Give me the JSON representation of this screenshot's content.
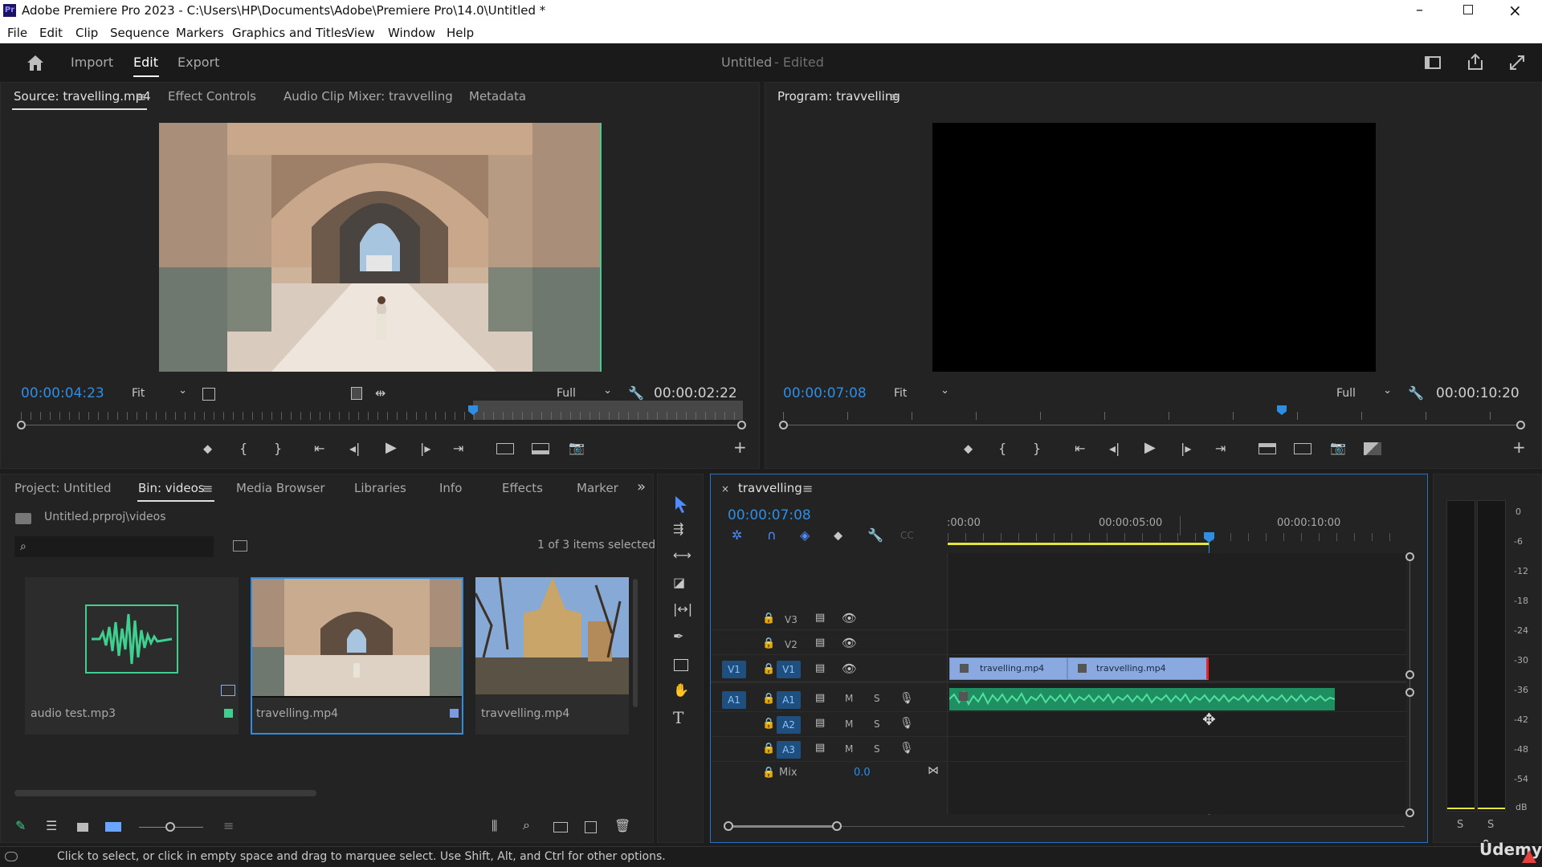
{
  "window": {
    "title": "Adobe Premiere Pro 2023 - C:\\Users\\HP\\Documents\\Adobe\\Premiere Pro\\14.0\\Untitled *",
    "app_icon": "Pr"
  },
  "menu": [
    "File",
    "Edit",
    "Clip",
    "Sequence",
    "Markers",
    "Graphics and Titles",
    "View",
    "Window",
    "Help"
  ],
  "header": {
    "tabs": [
      "Import",
      "Edit",
      "Export"
    ],
    "active_tab": "Edit",
    "project_title": "Untitled",
    "project_state": "- Edited"
  },
  "source_panel": {
    "tabs": [
      "Source: travelling.mp4",
      "Effect Controls",
      "Audio Clip Mixer: travvelling",
      "Metadata"
    ],
    "timecode": "00:00:04:23",
    "fit": "Fit",
    "quality": "Full",
    "duration": "00:00:02:22"
  },
  "program_panel": {
    "tab": "Program: travvelling",
    "timecode": "00:00:07:08",
    "fit": "Fit",
    "quality": "Full",
    "duration": "00:00:10:20"
  },
  "project_panel": {
    "tabs": [
      "Project: Untitled",
      "Bin: videos",
      "Media Browser",
      "Libraries",
      "Info",
      "Effects",
      "Marker"
    ],
    "path": "Untitled.prproj\\videos",
    "selection": "1 of 3 items selected",
    "items": [
      {
        "name": "audio test.mp3",
        "badge_color": "#3fcf8e"
      },
      {
        "name": "travelling.mp4",
        "badge_color": "#7a9be0"
      },
      {
        "name": "travvelling.mp4",
        "badge_color": ""
      }
    ]
  },
  "timeline": {
    "sequence_name": "travvelling",
    "timecode": "00:00:07:08",
    "ruler": [
      ":00:00",
      "00:00:05:00",
      "00:00:10:00"
    ],
    "video_tracks": [
      "V3",
      "V2",
      "V1"
    ],
    "audio_tracks": [
      "A1",
      "A2",
      "A3"
    ],
    "source_patch_video": "V1",
    "source_patch_audio": "A1",
    "mix_label": "Mix",
    "mix_value": "0.0",
    "clips": [
      "travelling.mp4",
      "travvelling.mp4"
    ],
    "mute_label": "M",
    "solo_label": "S"
  },
  "meter": {
    "scale": [
      "0",
      "-6",
      "-12",
      "-18",
      "-24",
      "-30",
      "-36",
      "-42",
      "-48",
      "-54",
      "dB"
    ],
    "solo_buttons": [
      "S",
      "S"
    ]
  },
  "status": {
    "text": "Click to select, or click in empty space and drag to marquee select. Use Shift, Alt, and Ctrl for other options."
  },
  "watermark": "Ûdemy",
  "colors": {
    "accent_blue": "#2f8de4",
    "clip_video": "#8aa9e0",
    "clip_audio": "#27b07a",
    "work_area": "#e6e63a"
  }
}
